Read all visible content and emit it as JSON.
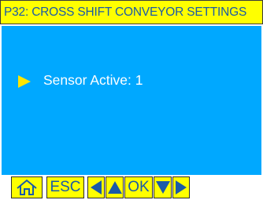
{
  "header": {
    "title": "P32: CROSS SHIFT CONVEYOR SETTINGS"
  },
  "settings": [
    {
      "label": "Sensor Active: 1",
      "selected": true
    }
  ],
  "navbar": {
    "home_icon": "home-icon",
    "esc_label": "ESC",
    "left_icon": "arrow-left-icon",
    "up_icon": "arrow-up-icon",
    "ok_label": "OK",
    "down_icon": "arrow-down-icon",
    "right_icon": "arrow-right-icon"
  },
  "colors": {
    "panel_background": "#00a8ff",
    "bar_background": "#ffff00",
    "text_blue": "#1a5aa8",
    "selection_arrow": "#ffe600"
  }
}
